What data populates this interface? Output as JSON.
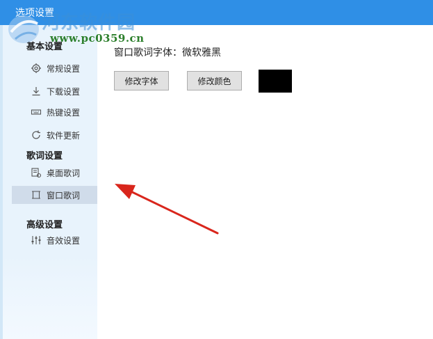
{
  "window": {
    "title": "选项设置"
  },
  "watermark": {
    "text": "河东软件园",
    "url": "www.pc0359.cn"
  },
  "sidebar": {
    "sections": [
      {
        "label": "基本设置"
      },
      {
        "label": "歌词设置"
      },
      {
        "label": "高级设置"
      }
    ],
    "items": [
      {
        "label": "常规设置",
        "icon": "gear-icon"
      },
      {
        "label": "下载设置",
        "icon": "download-icon"
      },
      {
        "label": "热键设置",
        "icon": "keyboard-icon"
      },
      {
        "label": "软件更新",
        "icon": "update-icon"
      },
      {
        "label": "桌面歌词",
        "icon": "desktop-lyrics-icon"
      },
      {
        "label": "窗口歌词",
        "icon": "window-lyrics-icon",
        "selected": true
      },
      {
        "label": "音效设置",
        "icon": "equalizer-icon"
      }
    ]
  },
  "lyrics": {
    "font_label": "窗口歌词字体：",
    "font_value": "微软雅黑",
    "change_font": "修改字体",
    "change_color": "修改颜色",
    "color": "#000000"
  },
  "colors": {
    "titlebar": "#2f8fe6",
    "sidebar": "#e8f3fc",
    "selected": "#d0dcea",
    "annotation_arrow": "#d9261c"
  }
}
